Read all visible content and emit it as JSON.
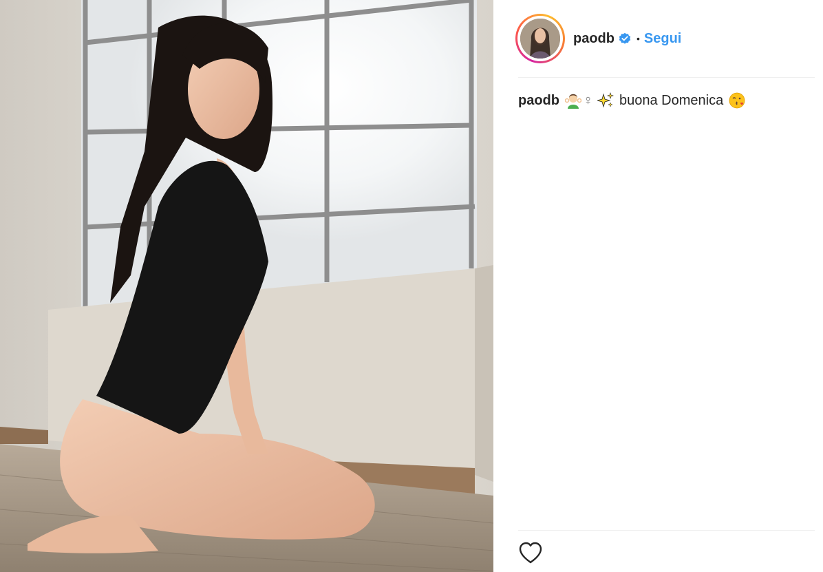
{
  "post": {
    "username": "paodb",
    "separator": "•",
    "follow_label": "Segui",
    "caption": {
      "username": "paodb",
      "female_sign": "♀",
      "text": "buona Domenica"
    }
  },
  "icons": {
    "verified": "verified-badge-icon",
    "like": "heart-outline-icon",
    "caption_emojis": [
      "woman-gesturing-ok-emoji",
      "sparkles-emoji",
      "face-blowing-kiss-emoji"
    ]
  },
  "colors": {
    "link_blue": "#3897f0",
    "text": "#262626",
    "divider": "#efefef"
  }
}
